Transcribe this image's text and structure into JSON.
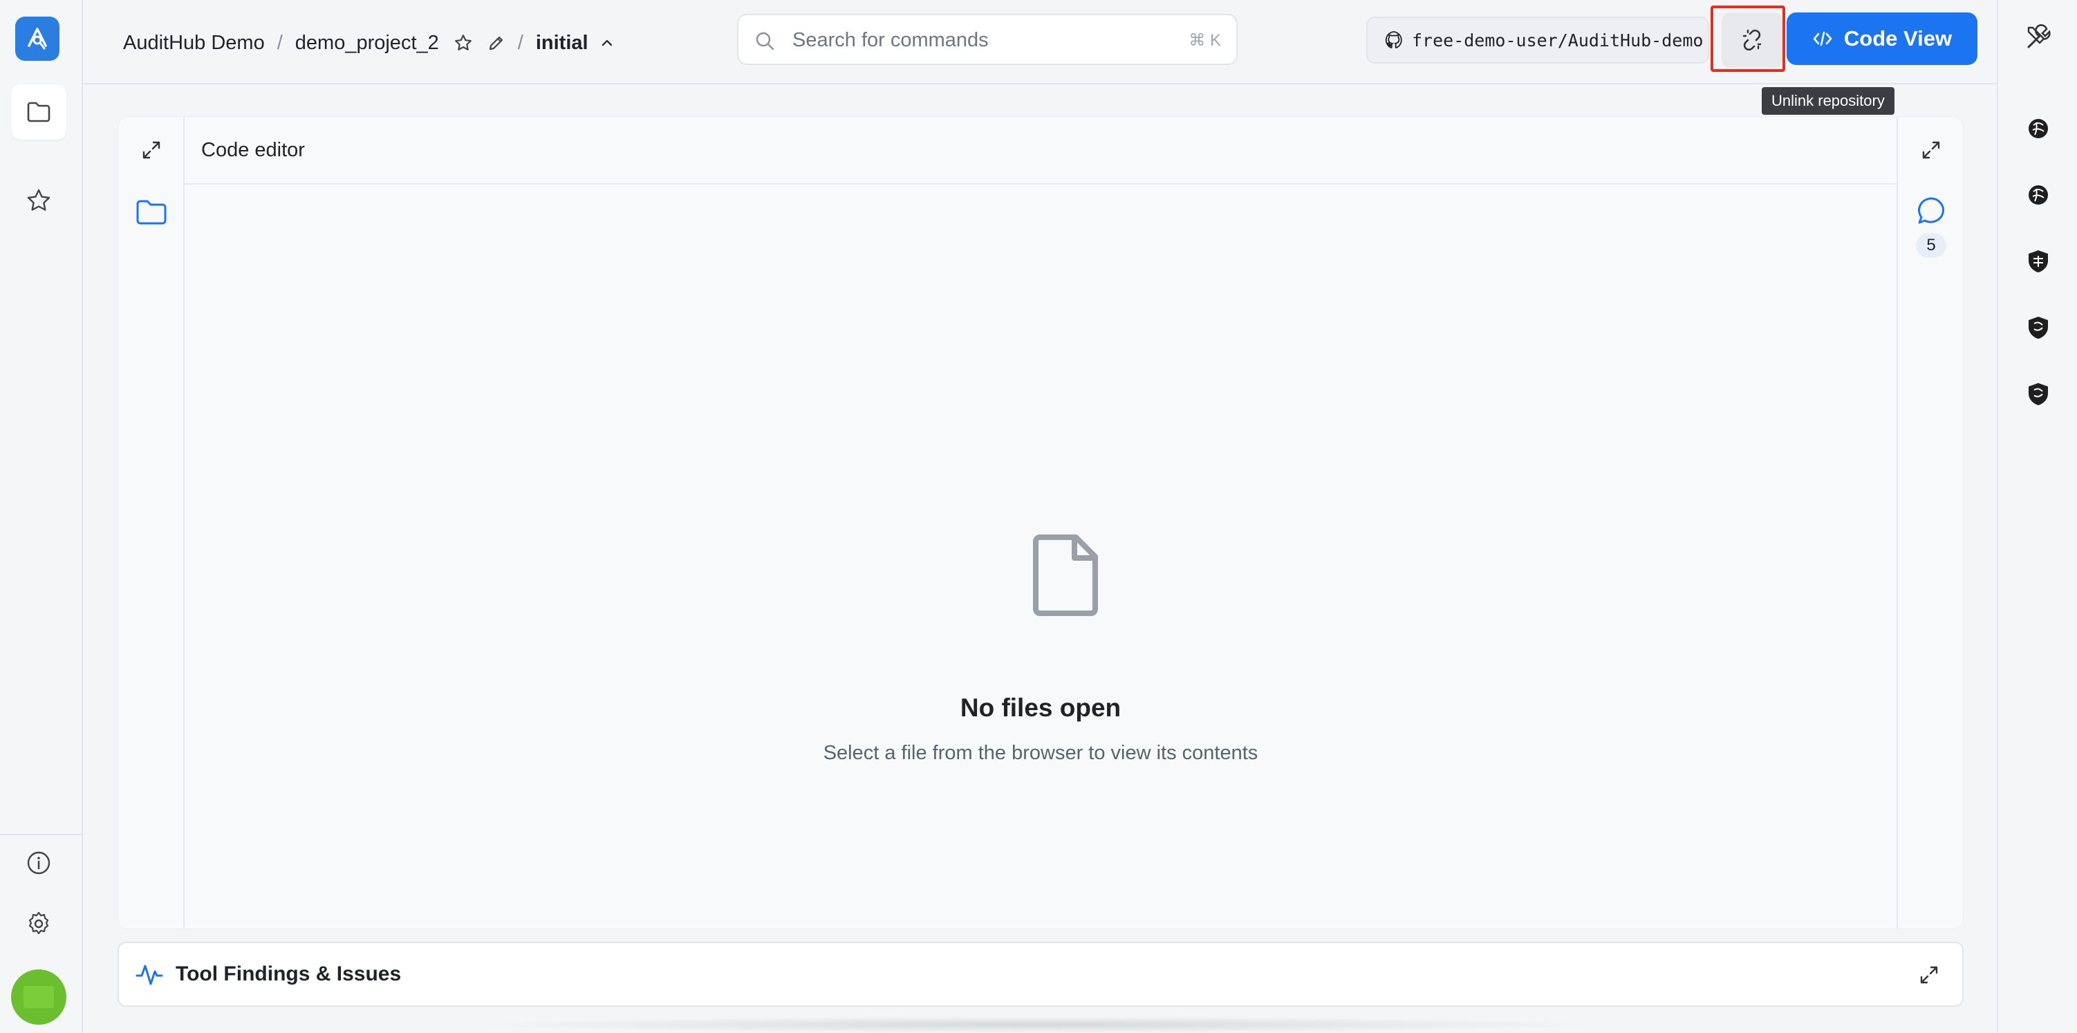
{
  "header": {
    "breadcrumb": {
      "org": "AuditHub Demo",
      "separator": "/",
      "project": "demo_project_2",
      "version": "initial"
    },
    "search": {
      "placeholder": "Search for commands",
      "shortcut": "⌘ K"
    },
    "repo": {
      "name": "free-demo-user/AuditHub-demo"
    },
    "unlink_tooltip": "Unlink repository",
    "code_view_label": "Code View"
  },
  "editor": {
    "title": "Code editor",
    "comments_count": "5",
    "empty_title": "No files open",
    "empty_subtitle": "Select a file from the browser to view its contents"
  },
  "findings": {
    "label": "Tool Findings & Issues"
  },
  "colors": {
    "accent": "#1b75f0",
    "logo_bg": "#2a7de1",
    "avatar": "#6bbf2f",
    "highlight": "#e0301e"
  },
  "icons": {
    "left_rail": [
      "app-logo-icon",
      "folder-icon",
      "star-icon",
      "info-icon",
      "gear-icon"
    ],
    "right_rail": [
      "wrench-screwdriver-icon",
      "brain-icon",
      "brain-icon",
      "shield-icon",
      "shield-icon",
      "shield-icon"
    ]
  }
}
